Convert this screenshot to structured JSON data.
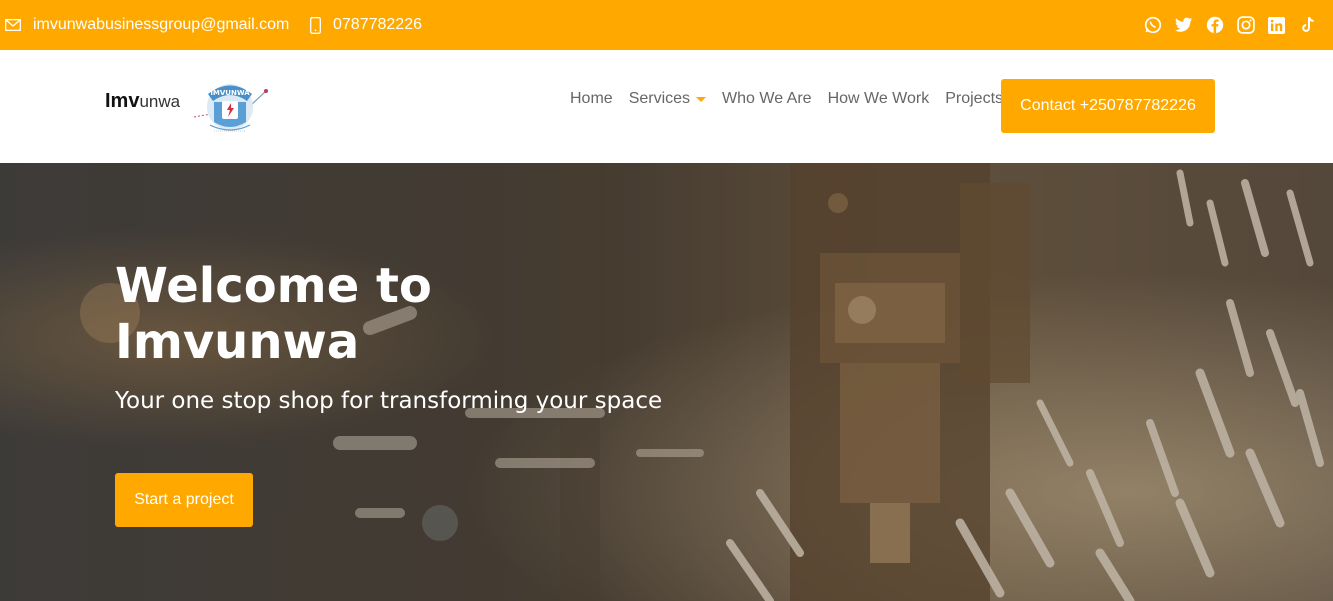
{
  "topbar": {
    "email": "imvunwabusinessgroup@gmail.com",
    "phone": "0787782226",
    "socials": [
      "whatsapp-icon",
      "twitter-icon",
      "facebook-icon",
      "instagram-icon",
      "linkedin-icon",
      "tiktok-icon"
    ]
  },
  "brand": {
    "bold": "Imv",
    "rest": "unwa",
    "logo_text": "IMVUNWA"
  },
  "nav": {
    "items": [
      {
        "label": "Home"
      },
      {
        "label": "Services"
      },
      {
        "label": "Who We Are"
      },
      {
        "label": "How We Work"
      },
      {
        "label": "Projects"
      }
    ],
    "contact_button": "Contact +250787782226"
  },
  "hero": {
    "title": "Welcome to Imvunwa",
    "tagline": "Your one stop shop for transforming your space",
    "cta": "Start a project"
  },
  "colors": {
    "accent": "#FFA800"
  }
}
